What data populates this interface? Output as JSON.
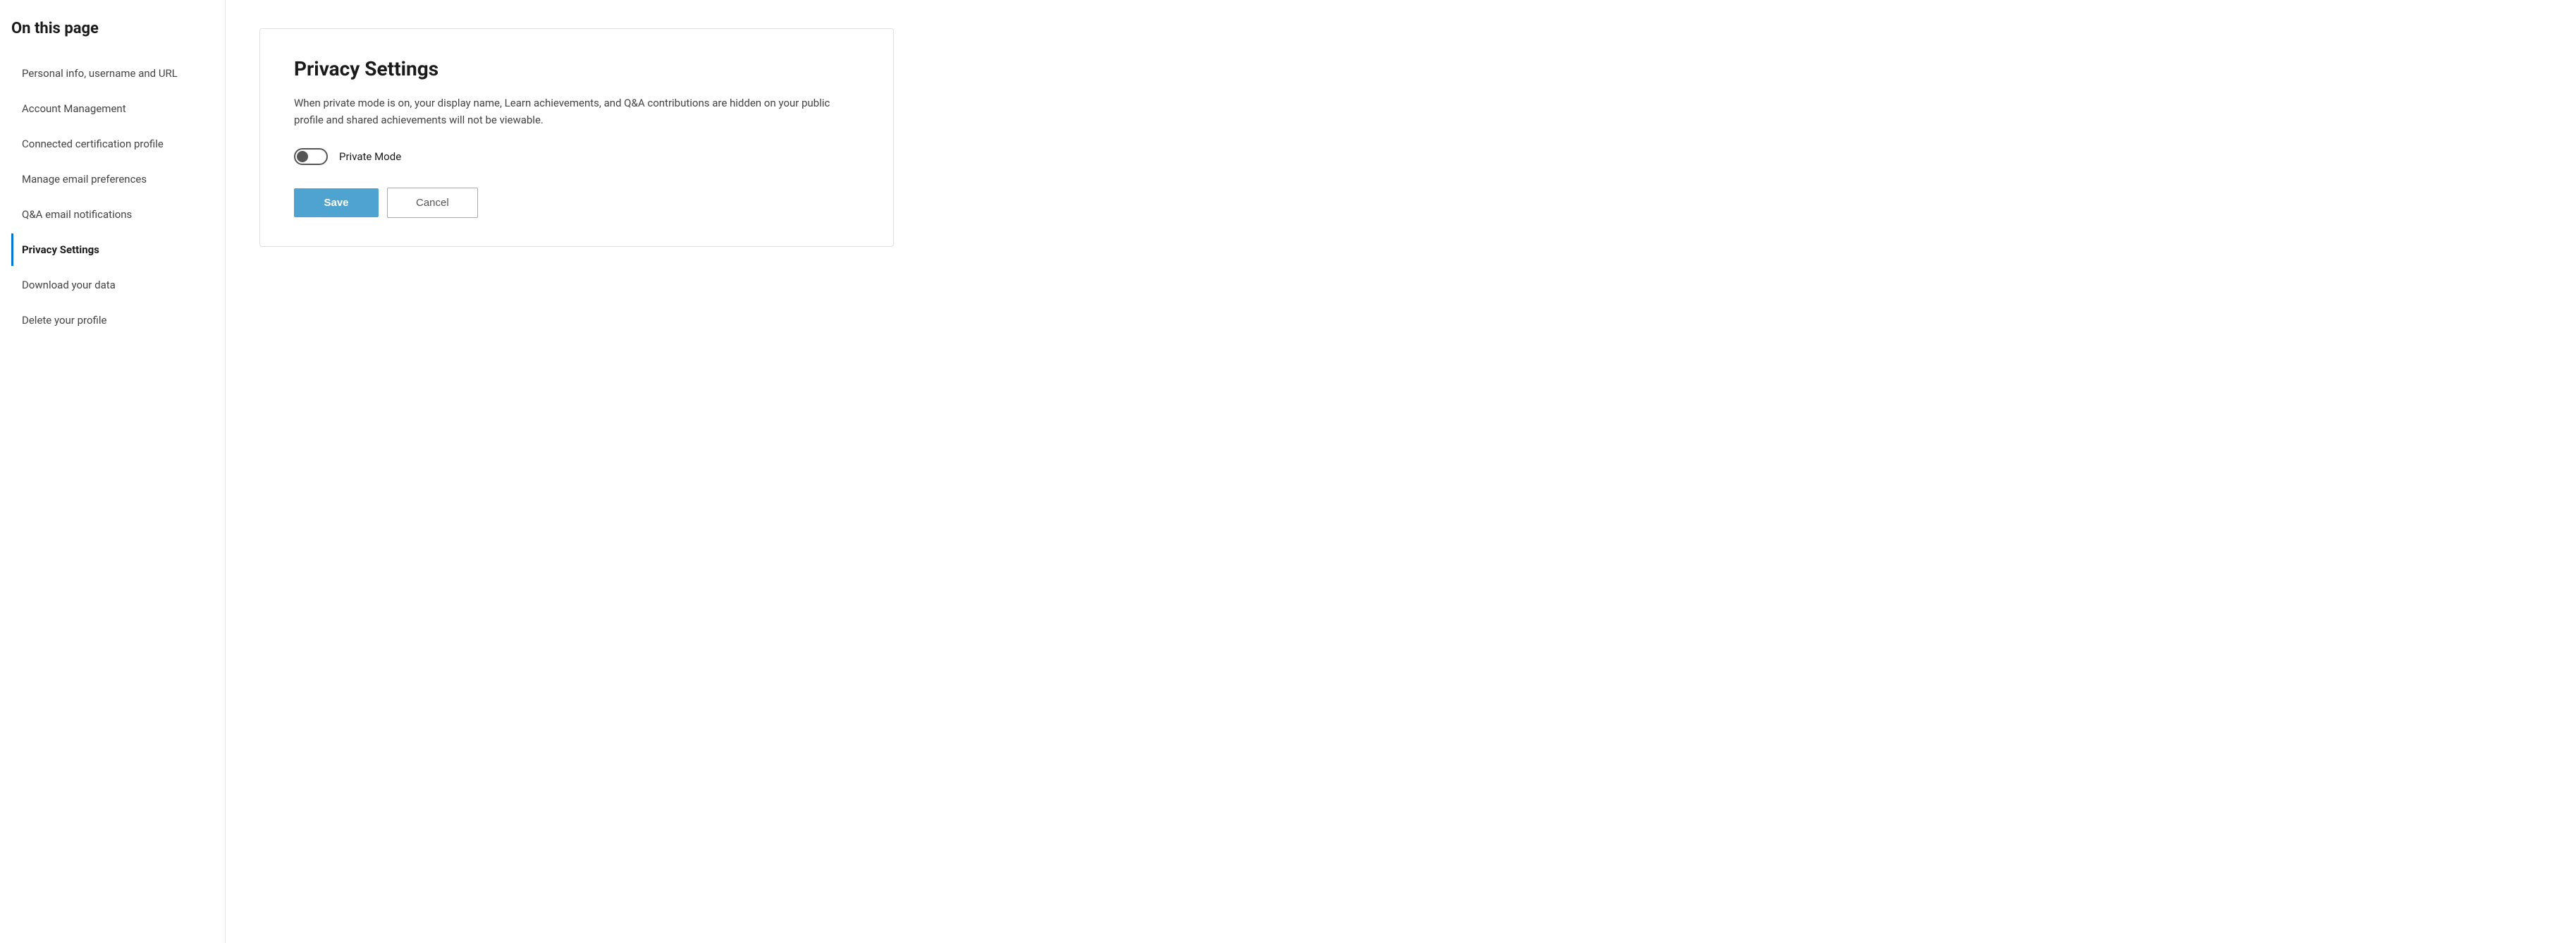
{
  "sidebar": {
    "title": "On this page",
    "items": [
      {
        "id": "personal-info",
        "label": "Personal info, username and URL",
        "active": false
      },
      {
        "id": "account-management",
        "label": "Account Management",
        "active": false
      },
      {
        "id": "connected-certification",
        "label": "Connected certification profile",
        "active": false
      },
      {
        "id": "manage-email",
        "label": "Manage email preferences",
        "active": false
      },
      {
        "id": "qa-email",
        "label": "Q&A email notifications",
        "active": false
      },
      {
        "id": "privacy-settings",
        "label": "Privacy Settings",
        "active": true
      },
      {
        "id": "download-data",
        "label": "Download your data",
        "active": false
      },
      {
        "id": "delete-profile",
        "label": "Delete your profile",
        "active": false
      }
    ]
  },
  "main": {
    "section_title": "Privacy Settings",
    "section_description": "When private mode is on, your display name, Learn achievements, and Q&A contributions are hidden on your public profile and shared achievements will not be viewable.",
    "toggle_label": "Private Mode",
    "toggle_checked": false,
    "save_button": "Save",
    "cancel_button": "Cancel"
  }
}
